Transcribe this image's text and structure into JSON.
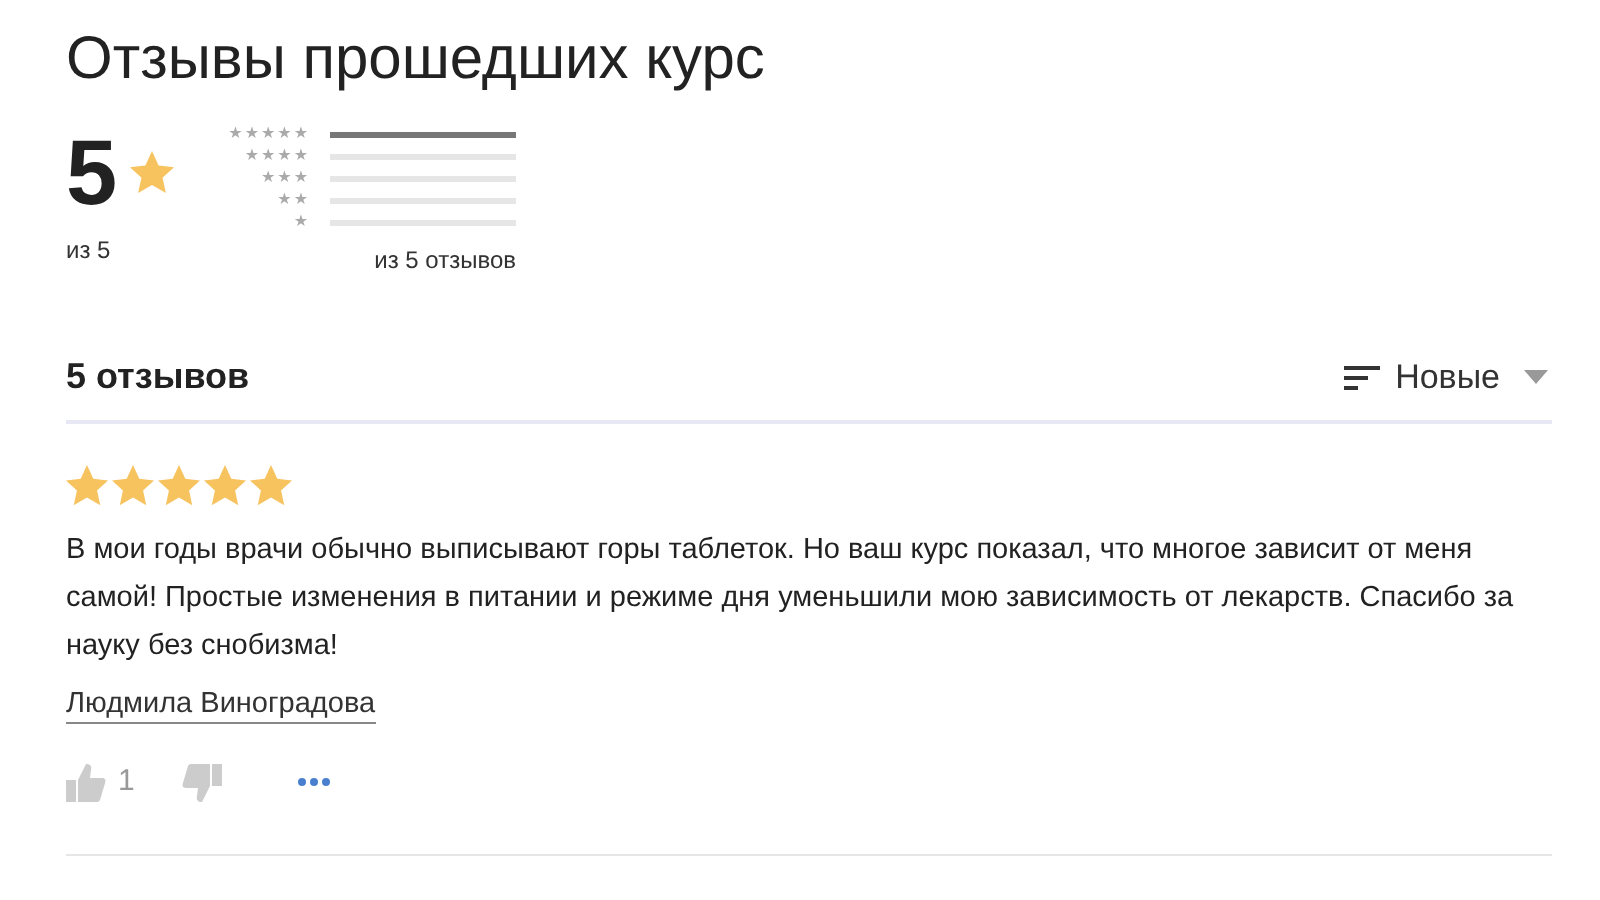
{
  "title": "Отзывы прошедших курс",
  "summary": {
    "score": "5",
    "of": "из 5",
    "count": "из 5 отзывов"
  },
  "distribution": [
    {
      "label": "★★★★★",
      "level": 1
    },
    {
      "label": "★★★★",
      "level": 0
    },
    {
      "label": "★★★",
      "level": 0
    },
    {
      "label": "★★",
      "level": 0
    },
    {
      "label": "★",
      "level": 0
    }
  ],
  "reviews_header": {
    "count": "5 отзывов",
    "sort": "Новые"
  },
  "reviews": [
    {
      "stars": 5,
      "text": "В мои годы врачи обычно выписывают горы таблеток. Но ваш курс показал, что многое зависит от меня самой! Простые изменения в питании и режиме дня уменьшили мою зависимость от лекарств. Спасибо за науку без снобизма!",
      "author": "Людмила Виноградова",
      "likes": "1"
    }
  ]
}
